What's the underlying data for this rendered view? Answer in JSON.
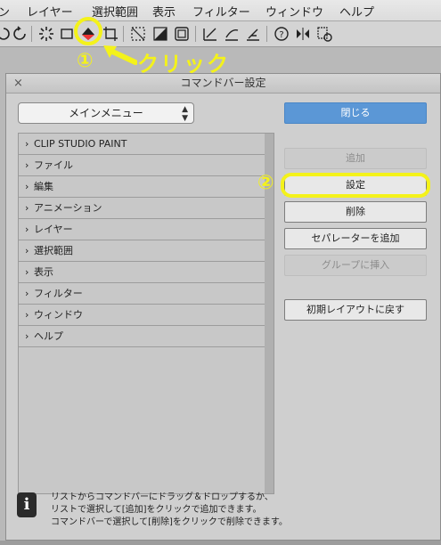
{
  "menubar": {
    "items": [
      {
        "label": "ン"
      },
      {
        "label": "レイヤー"
      },
      {
        "label": "選択範囲"
      },
      {
        "label": "表示"
      },
      {
        "label": "フィルター"
      },
      {
        "label": "ウィンドウ"
      },
      {
        "label": "ヘルプ"
      }
    ]
  },
  "annotations": {
    "step1": "①",
    "click": "クリック",
    "step2": "②"
  },
  "dialog": {
    "title": "コマンドバー設定",
    "close": "×",
    "dropdown_value": "メインメニュー",
    "list_items": [
      {
        "label": "CLIP STUDIO PAINT"
      },
      {
        "label": "ファイル"
      },
      {
        "label": "編集"
      },
      {
        "label": "アニメーション"
      },
      {
        "label": "レイヤー"
      },
      {
        "label": "選択範囲"
      },
      {
        "label": "表示"
      },
      {
        "label": "フィルター"
      },
      {
        "label": "ウィンドウ"
      },
      {
        "label": "ヘルプ"
      }
    ],
    "buttons": {
      "close": "閉じる",
      "add": "追加",
      "settings": "設定",
      "delete": "削除",
      "add_separator": "セパレーターを追加",
      "insert_group": "グループに挿入",
      "reset_layout": "初期レイアウトに戻す"
    },
    "info": {
      "icon": "i",
      "line1": "リストからコマンドバーにドラッグ＆ドロップするか、",
      "line2": "リストで選択して[追加]をクリックで追加できます。",
      "line3": "コマンドバーで選択して[削除]をクリックで削除できます。"
    }
  },
  "colors": {
    "annotation": "#f4f21a",
    "primary_button": "#5b97d6"
  }
}
